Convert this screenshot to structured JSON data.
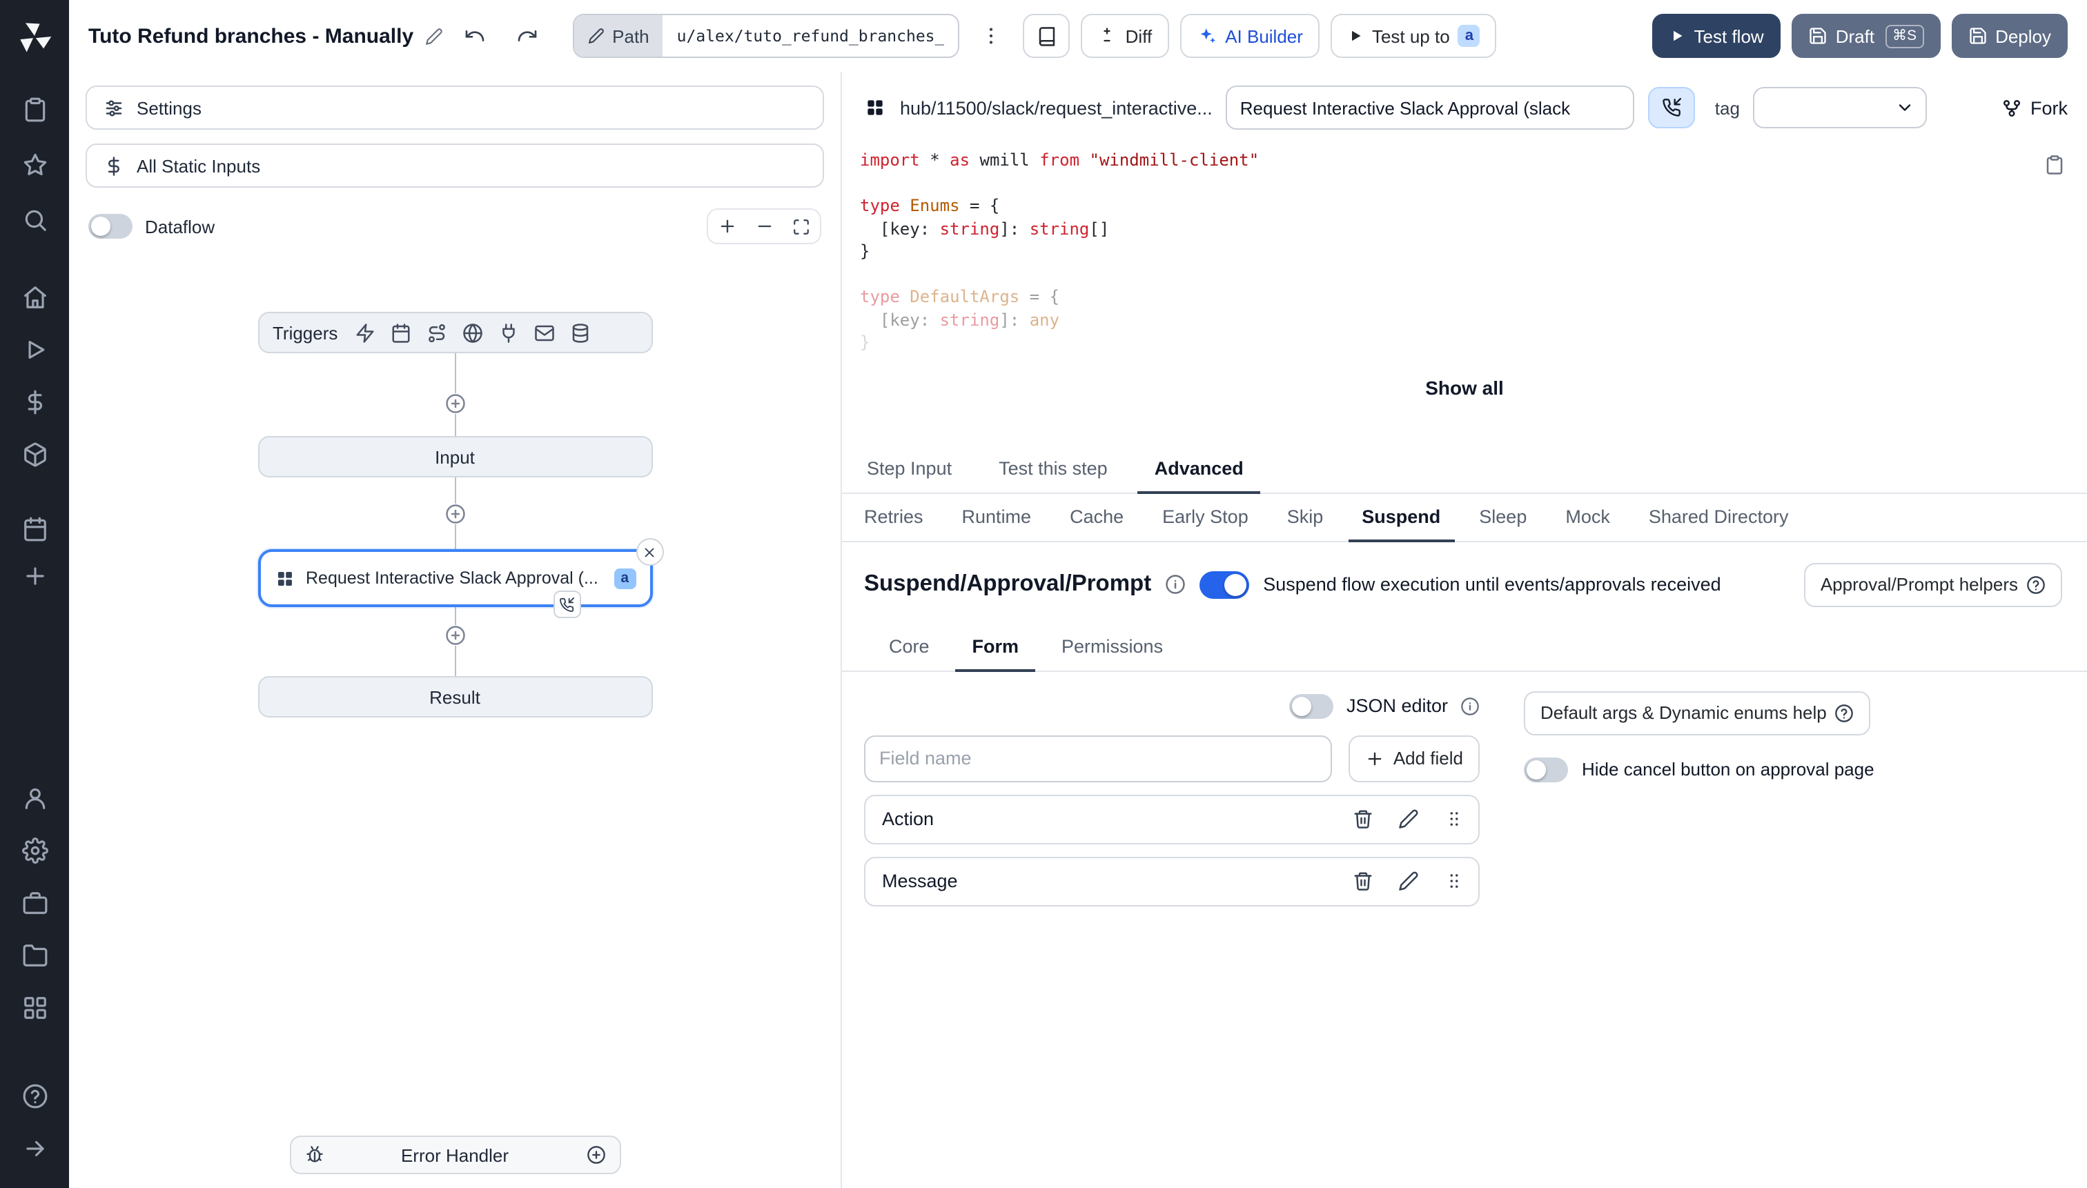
{
  "app": {
    "accent_color": "#2563eb",
    "rail_color": "#1c2028"
  },
  "rail": {
    "groups": {
      "top": [
        "clipboard",
        "star",
        "search"
      ],
      "mid": [
        "home",
        "play",
        "dollar",
        "box"
      ],
      "mid2": [
        "calendar",
        "plus"
      ],
      "bottom": [
        "user",
        "settings",
        "briefcase",
        "folder",
        "grid"
      ],
      "foot": [
        "help",
        "arrow-right"
      ]
    }
  },
  "header": {
    "title": "Tuto Refund branches - Manually",
    "path_label": "Path",
    "path_value": "u/alex/tuto_refund_branches__",
    "diff_label": "Diff",
    "ai_builder_label": "AI Builder",
    "test_up_to_label": "Test up to",
    "test_up_to_badge": "a",
    "test_flow_label": "Test flow",
    "draft_label": "Draft",
    "draft_shortcut": "⌘S",
    "deploy_label": "Deploy"
  },
  "left_panel": {
    "settings_label": "Settings",
    "static_inputs_label": "All Static Inputs",
    "dataflow_label": "Dataflow",
    "graph": {
      "triggers_label": "Triggers",
      "trigger_icons": [
        "webhook",
        "schedule",
        "route",
        "websocket",
        "postgres",
        "email",
        "kafka"
      ],
      "input_label": "Input",
      "step_label": "Request Interactive Slack Approval (...",
      "step_badge": "a",
      "result_label": "Result",
      "error_handler_label": "Error Handler"
    }
  },
  "right_panel": {
    "hub_path": "hub/11500/slack/request_interactive...",
    "summary_value": "Request Interactive Slack Approval (slack",
    "tag_label": "tag",
    "fork_label": "Fork",
    "show_all_label": "Show all",
    "code_lines": [
      {
        "f": "",
        "t": [
          [
            "import",
            "kw"
          ],
          [
            " ",
            "pl"
          ],
          [
            "*",
            "pl"
          ],
          [
            " ",
            "pl"
          ],
          [
            "as",
            "kw"
          ],
          [
            " ",
            "pl"
          ],
          [
            "wmill",
            "pl"
          ],
          [
            " ",
            "pl"
          ],
          [
            "from",
            "kw"
          ],
          [
            " ",
            "pl"
          ],
          [
            "\"windmill-client\"",
            "st"
          ]
        ]
      },
      {
        "f": "",
        "t": []
      },
      {
        "f": "",
        "t": [
          [
            "type",
            "kw"
          ],
          [
            " ",
            "pl"
          ],
          [
            "Enums",
            "ty"
          ],
          [
            " = {",
            "pl"
          ]
        ]
      },
      {
        "f": "",
        "t": [
          [
            "  [key: ",
            "pl"
          ],
          [
            "string",
            "kw"
          ],
          [
            "]: ",
            "pl"
          ],
          [
            "string",
            "kw"
          ],
          [
            "[]",
            "pl"
          ]
        ]
      },
      {
        "f": "",
        "t": [
          [
            "}",
            "pl"
          ]
        ]
      },
      {
        "f": "",
        "t": []
      },
      {
        "f": "faded",
        "t": [
          [
            "type",
            "kw"
          ],
          [
            " ",
            "pl"
          ],
          [
            "DefaultArgs",
            "ty"
          ],
          [
            " = {",
            "pl"
          ]
        ]
      },
      {
        "f": "faded",
        "t": [
          [
            "  [key: ",
            "pl"
          ],
          [
            "string",
            "kw"
          ],
          [
            "]: ",
            "pl"
          ],
          [
            "any",
            "ty"
          ]
        ]
      },
      {
        "f": "faded2",
        "t": [
          [
            "}",
            "pl"
          ]
        ]
      }
    ],
    "tabs_primary": {
      "items": [
        "Step Input",
        "Test this step",
        "Advanced"
      ],
      "active": "Advanced"
    },
    "tabs_advanced": {
      "items": [
        "Retries",
        "Runtime",
        "Cache",
        "Early Stop",
        "Skip",
        "Suspend",
        "Sleep",
        "Mock",
        "Shared Directory"
      ],
      "active": "Suspend"
    },
    "suspend": {
      "title": "Suspend/Approval/Prompt",
      "toggle_label": "Suspend flow execution until events/approvals received",
      "toggle_on": true,
      "helpers_label": "Approval/Prompt helpers",
      "tabs": {
        "items": [
          "Core",
          "Form",
          "Permissions"
        ],
        "active": "Form"
      },
      "json_editor_label": "JSON editor",
      "json_editor_on": false,
      "field_name_placeholder": "Field name",
      "add_field_label": "Add field",
      "default_args_help_label": "Default args & Dynamic enums help",
      "hide_cancel_label": "Hide cancel button on approval page",
      "hide_cancel_on": false,
      "fields": [
        "Action",
        "Message"
      ]
    }
  }
}
